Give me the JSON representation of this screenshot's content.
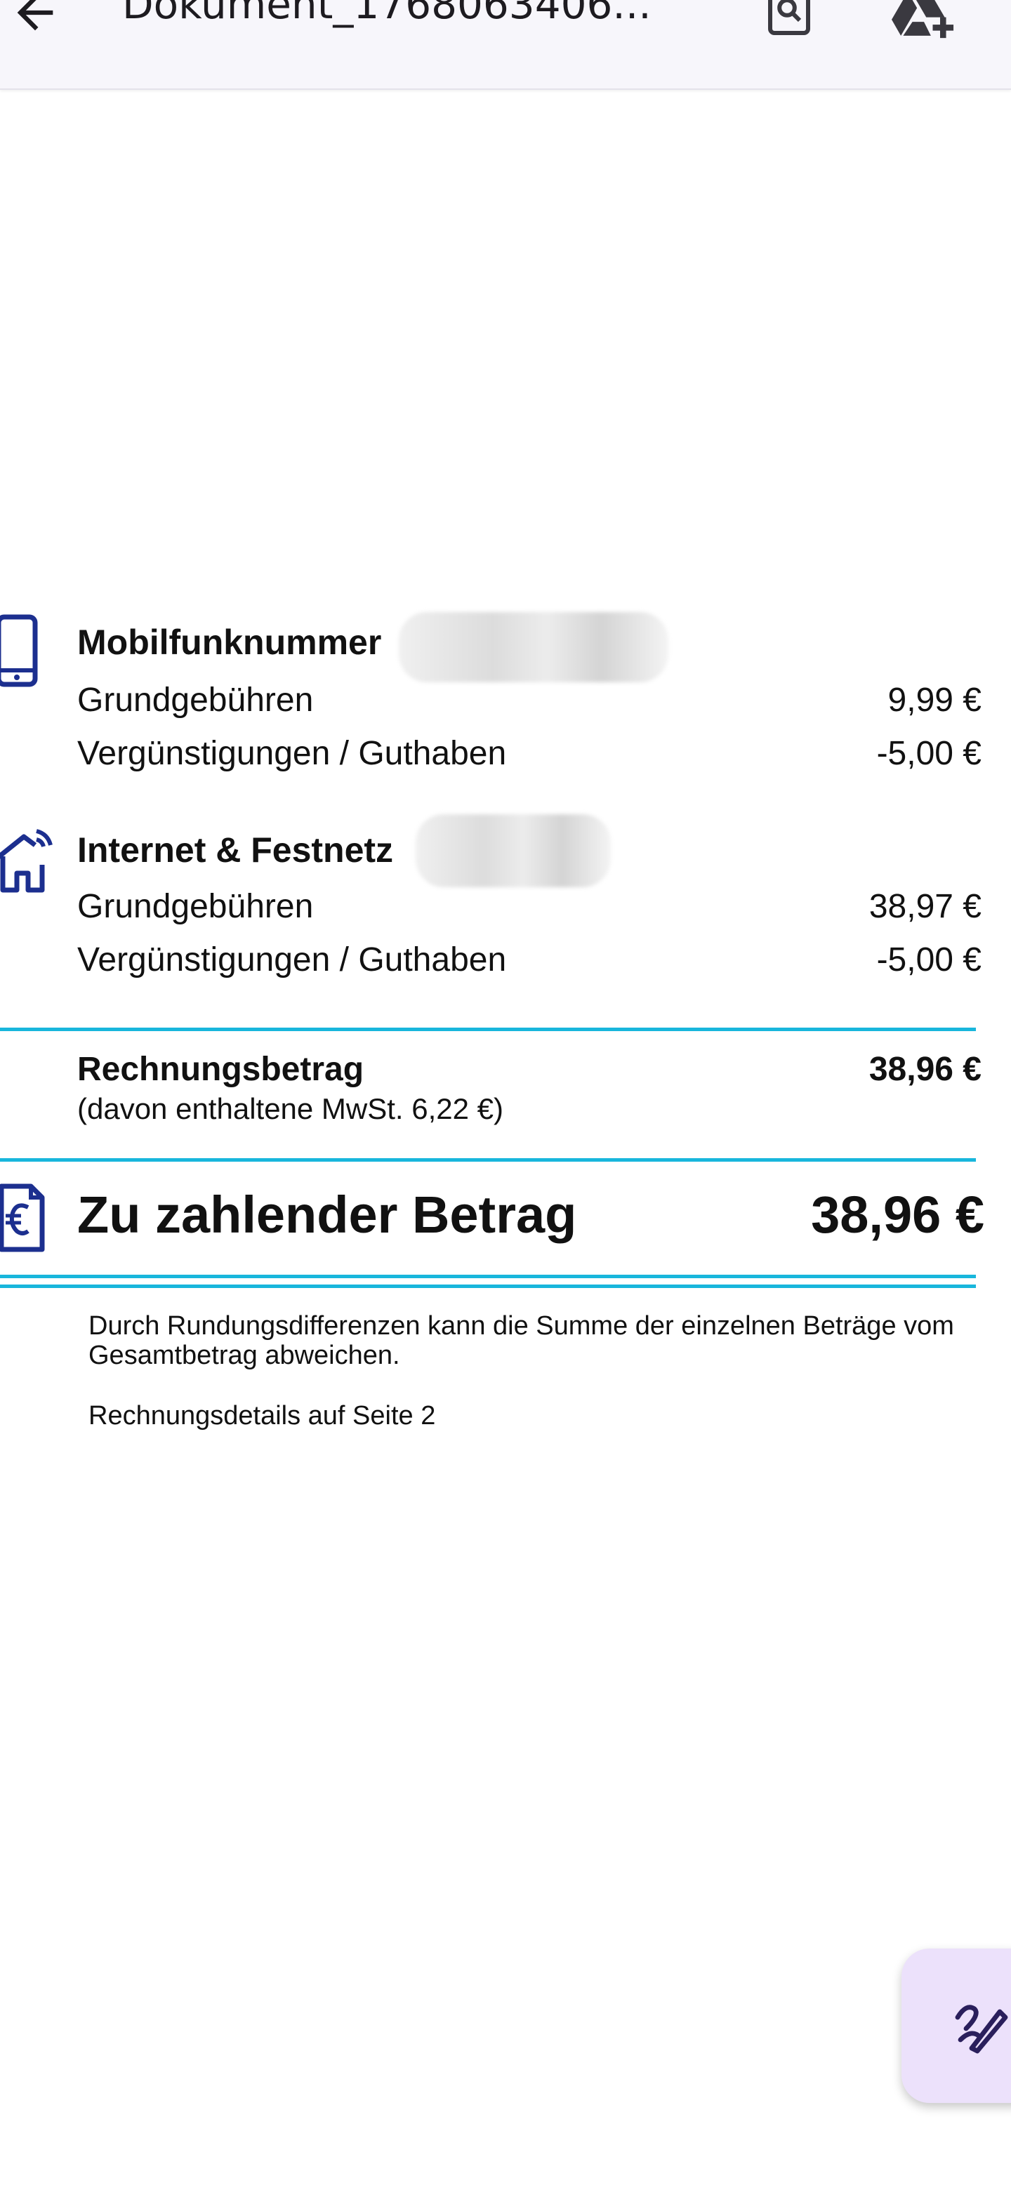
{
  "app_bar": {
    "title": "Dokument_1768063406...",
    "back_icon": "arrow-left-icon",
    "search_icon": "document-search-icon",
    "drive_icon": "add-to-drive-icon"
  },
  "invoice": {
    "sections": [
      {
        "icon": "mobile-phone-icon",
        "title": "Mobilfunknummer",
        "rows": [
          {
            "label": "Grundgebühren",
            "value": "9,99 €"
          },
          {
            "label": "Vergünstigungen / Guthaben",
            "value": "-5,00 €"
          }
        ]
      },
      {
        "icon": "home-signal-icon",
        "title": "Internet & Festnetz",
        "rows": [
          {
            "label": "Grundgebühren",
            "value": "38,97 €"
          },
          {
            "label": "Vergünstigungen / Guthaben",
            "value": "-5,00 €"
          }
        ]
      }
    ],
    "total": {
      "label": "Rechnungsbetrag",
      "value": "38,96 €",
      "vat_note": "(davon enthaltene MwSt. 6,22 €)"
    },
    "payable": {
      "icon": "euro-document-icon",
      "label": "Zu zahlender Betrag",
      "value": "38,96 €"
    },
    "notes": [
      "Durch Rundungsdifferenzen kann die Summe der einzelnen Beträge vom Gesamtbetrag abweichen.",
      "Rechnungsdetails auf Seite 2"
    ]
  },
  "fab": {
    "icon": "edit-pen-icon"
  },
  "colors": {
    "accent_rule": "#18b6dc",
    "icon_navy": "#1c2f8f",
    "fab_bg": "#ece1fb",
    "fab_icon": "#2a1f5c"
  }
}
